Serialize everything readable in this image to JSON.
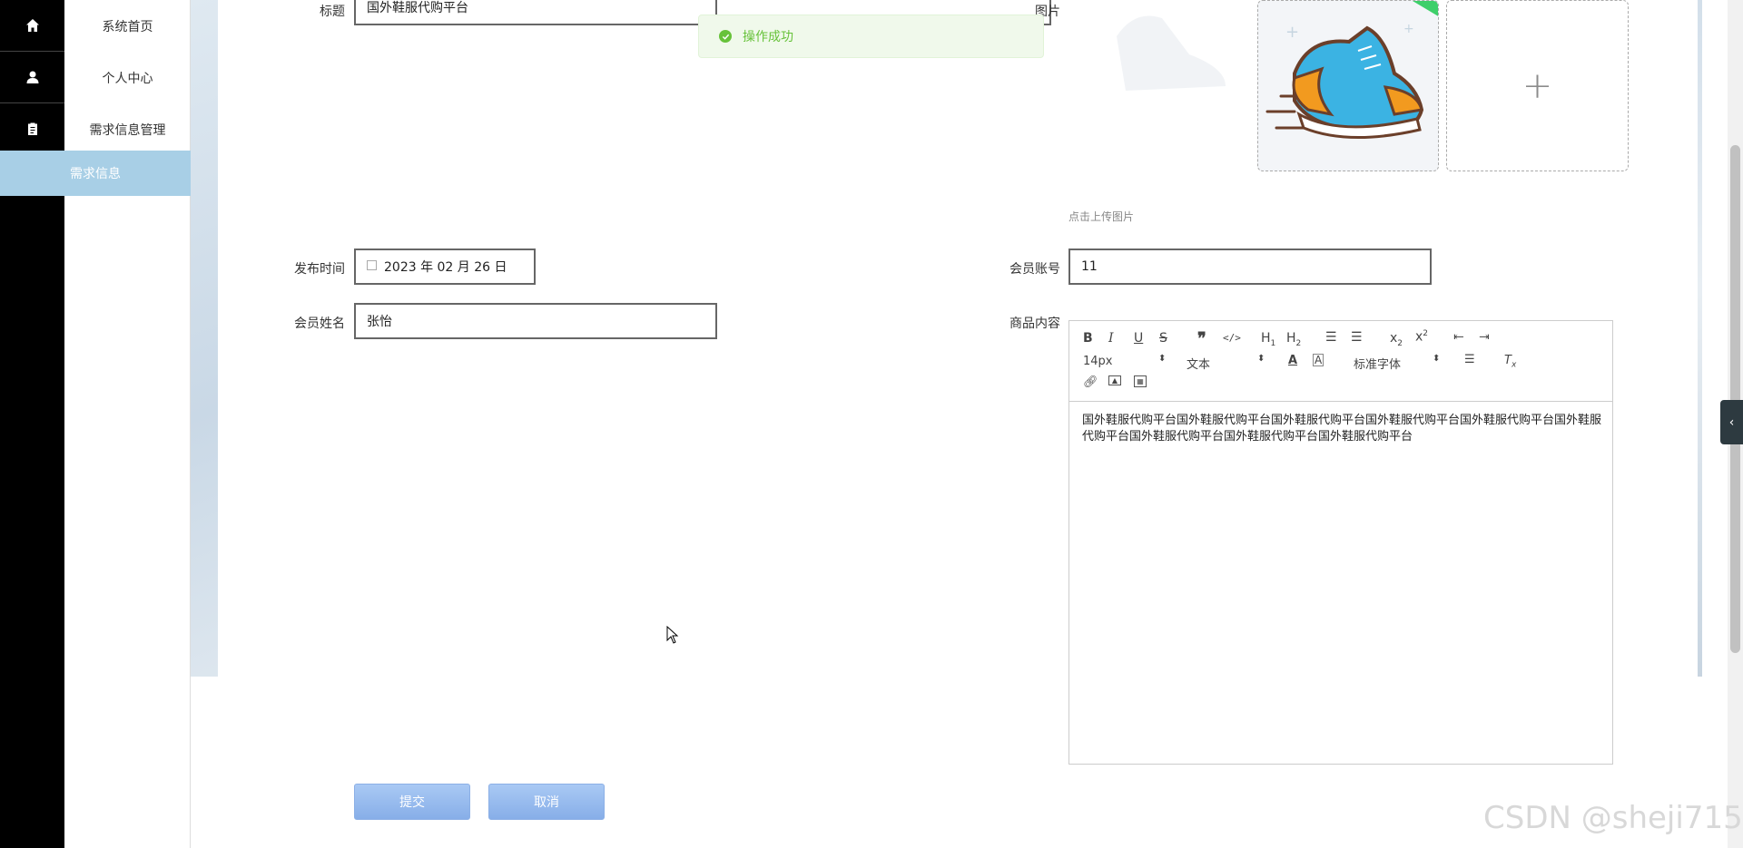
{
  "sidebar": {
    "items": [
      {
        "label": "系统首页",
        "icon": "home-icon"
      },
      {
        "label": "个人中心",
        "icon": "user-icon"
      },
      {
        "label": "需求信息管理",
        "icon": "clipboard-icon"
      }
    ],
    "active_sub": "需求信息"
  },
  "form": {
    "title_label": "标题",
    "title_value": "国外鞋服代购平台",
    "image_label": "图片",
    "upload_hint": "点击上传图片",
    "publish_time_label": "发布时间",
    "publish_time_value": "2023 年 02 月 26 日",
    "member_account_label": "会员账号",
    "member_account_value": "11",
    "member_name_label": "会员姓名",
    "member_name_value": "张怡",
    "content_label": "商品内容",
    "content_value": "国外鞋服代购平台国外鞋服代购平台国外鞋服代购平台国外鞋服代购平台国外鞋服代购平台国外鞋服代购平台国外鞋服代购平台国外鞋服代购平台国外鞋服代购平台"
  },
  "editor": {
    "font_size": "14px",
    "block_format": "文本",
    "font_family": "标准字体"
  },
  "toast": {
    "message": "操作成功"
  },
  "buttons": {
    "submit": "提交",
    "cancel": "取消"
  },
  "watermark": "CSDN @sheji715",
  "colors": {
    "accent": "#a8cfe6",
    "success": "#67c23a",
    "button": "#87aee8"
  }
}
